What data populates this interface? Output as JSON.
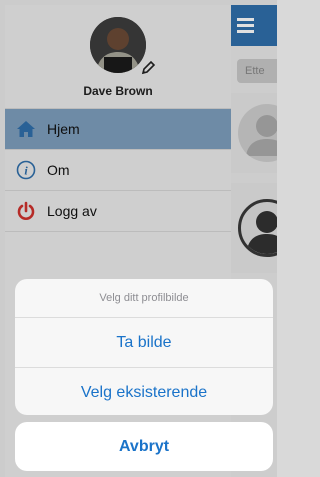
{
  "profile": {
    "name": "Dave Brown"
  },
  "menu": {
    "items": [
      {
        "label": "Hjem",
        "icon": "home-icon",
        "active": true
      },
      {
        "label": "Om",
        "icon": "info-icon",
        "active": false
      },
      {
        "label": "Logg av",
        "icon": "power-icon",
        "active": false
      }
    ]
  },
  "main": {
    "search_placeholder": "Ette"
  },
  "action_sheet": {
    "title": "Velg ditt profilbilde",
    "options": [
      "Ta bilde",
      "Velg eksisterende"
    ],
    "cancel": "Avbryt"
  },
  "colors": {
    "accent": "#1a73c9",
    "topbar": "#2f6fab",
    "active_menu": "#7e9fbe",
    "logout_red": "#d0312d"
  }
}
